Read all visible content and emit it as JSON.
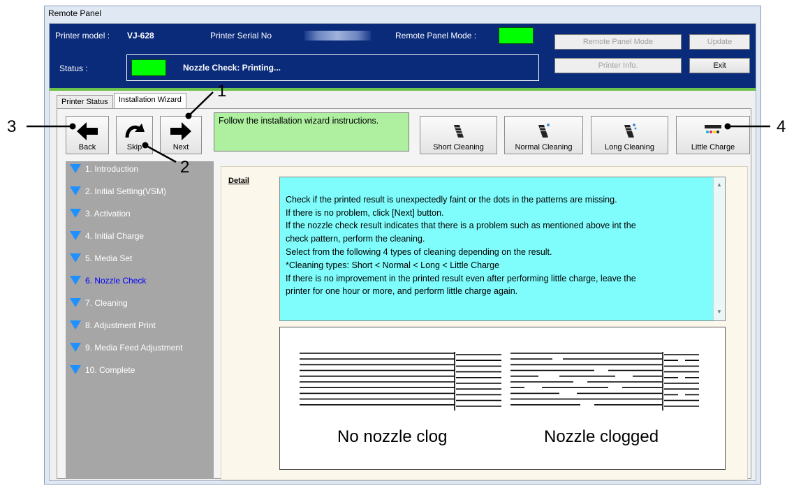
{
  "window": {
    "title": "Remote Panel"
  },
  "header": {
    "printer_model_label": "Printer model :",
    "printer_model_value": "VJ-628",
    "serial_label": "Printer Serial No",
    "remote_mode_label": "Remote Panel Mode :",
    "status_label": "Status :",
    "status_text": "Nozzle Check: Printing...",
    "buttons": {
      "remote_panel_mode": "Remote Panel Mode",
      "update": "Update",
      "printer_info": "Printer Info.",
      "exit": "Exit"
    }
  },
  "tabs": [
    {
      "label": "Printer Status"
    },
    {
      "label": "Installation Wizard"
    }
  ],
  "toolbar": {
    "back": "Back",
    "skip": "Skip",
    "next": "Next",
    "message": "Follow the installation wizard instructions.",
    "short_cleaning": "Short Cleaning",
    "normal_cleaning": "Normal Cleaning",
    "long_cleaning": "Long Cleaning",
    "little_charge": "Little Charge"
  },
  "steps": [
    {
      "label": "1. Introduction"
    },
    {
      "label": "2. Initial Setting(VSM)"
    },
    {
      "label": "3. Activation"
    },
    {
      "label": "4. Initial Charge"
    },
    {
      "label": "5. Media Set"
    },
    {
      "label": "6. Nozzle Check"
    },
    {
      "label": "7. Cleaning"
    },
    {
      "label": "8. Adjustment Print"
    },
    {
      "label": "9. Media Feed Adjustment"
    },
    {
      "label": "10. Complete"
    }
  ],
  "current_step": 6,
  "detail": {
    "title": "Detail",
    "text": "Check if the printed result is unexpectedly faint or the dots in the patterns are missing.\nIf there is no problem, click [Next] button.\nIf the nozzle check result indicates that there is a problem such as mentioned above int the\ncheck pattern, perform the cleaning.\nSelect from the following 4 types of cleaning depending on the result.\n  *Cleaning types: Short < Normal < Long < Little Charge\nIf there is no improvement in the printed result even after performing little charge, leave the\nprinter for one hour or more, and perform little charge again.",
    "caption_good": "No nozzle clog",
    "caption_bad": "Nozzle clogged"
  },
  "callouts": {
    "c1": "1",
    "c2": "2",
    "c3": "3",
    "c4": "4"
  },
  "colors": {
    "header_bg": "#0a2a7a",
    "lamp": "#00ff00",
    "message_bg": "#aef0a0",
    "detail_bg": "#7ffcfc",
    "sidebar_bg": "#a6a6a6",
    "step_icon": "#1e90ff",
    "current_step": "#0000ff"
  }
}
